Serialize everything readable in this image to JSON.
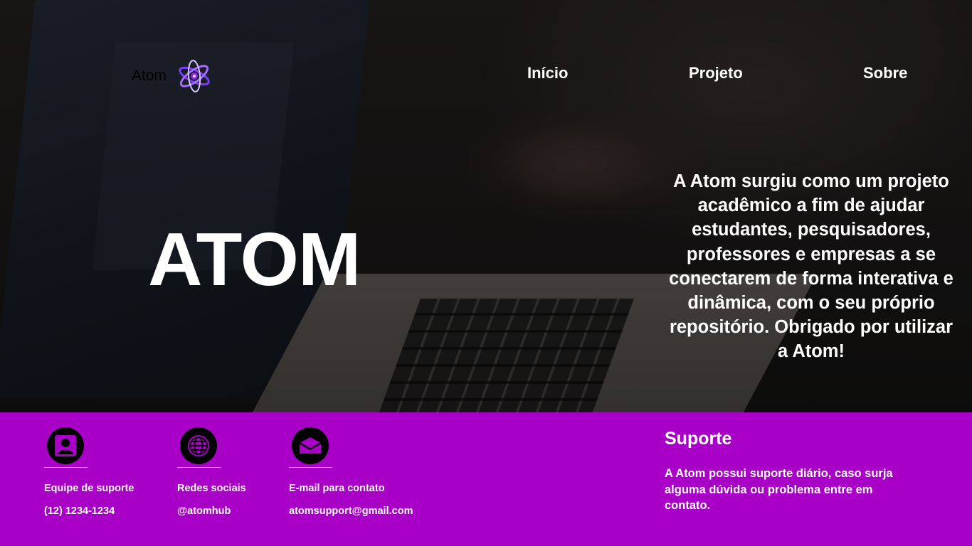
{
  "header": {
    "brand_name": "Atom",
    "brand_icon": "atom-logo-icon",
    "nav": [
      {
        "label": "Início"
      },
      {
        "label": "Projeto"
      },
      {
        "label": "Sobre"
      }
    ]
  },
  "hero": {
    "title": "ATOM",
    "description": "A Atom surgiu como um projeto acadêmico a fim de ajudar estudantes, pesquisadores, professores e empresas a se conectarem de forma interativa e dinâmica, com o seu próprio repositório. Obrigado por utilizar a Atom!"
  },
  "footer": {
    "background_color": "#a800c6",
    "contacts": [
      {
        "icon": "user-icon",
        "label": "Equipe de suporte",
        "value": "(12) 1234-1234"
      },
      {
        "icon": "globe-icon",
        "label": "Redes sociais",
        "value": "@atomhub"
      },
      {
        "icon": "mail-icon",
        "label": "E-mail para contato",
        "value": "atomsupport@gmail.com"
      }
    ],
    "support": {
      "title": "Suporte",
      "text": "A Atom possui suporte diário, caso surja alguma dúvida ou problema entre em contato."
    }
  }
}
